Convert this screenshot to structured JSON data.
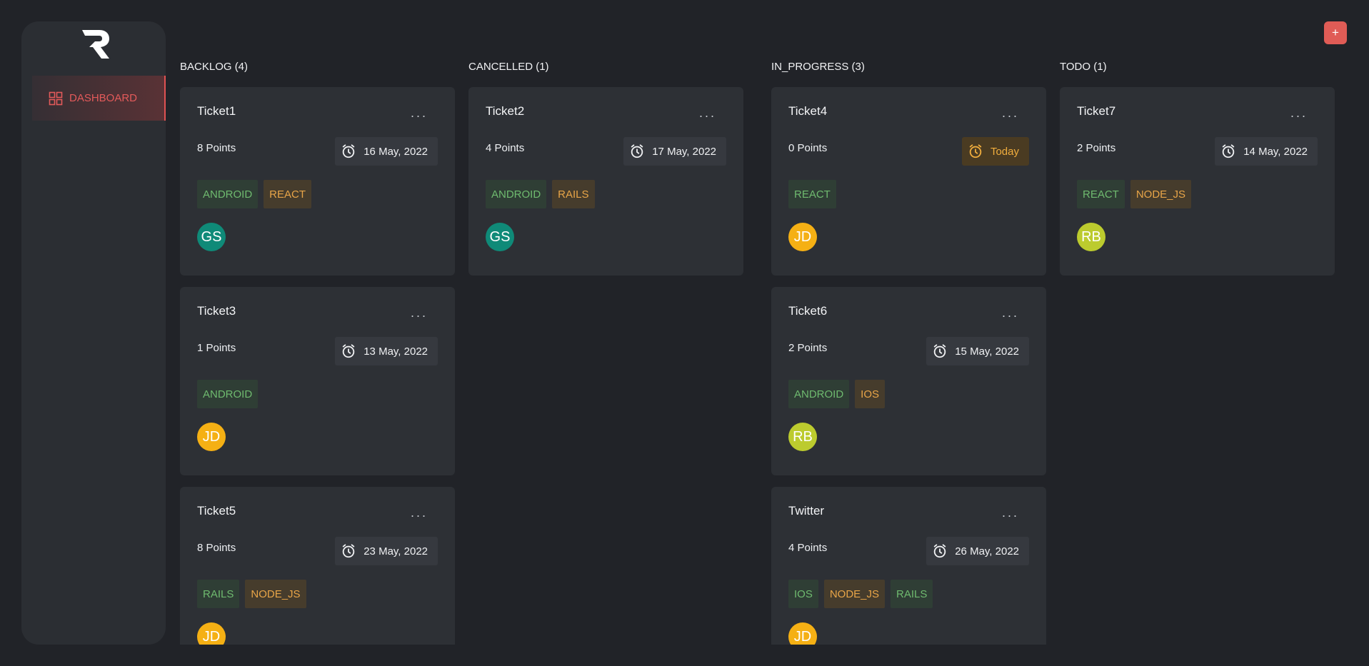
{
  "app": {
    "nav_label": "DASHBOARD",
    "add_button_label": "+"
  },
  "colors": {
    "background": "#212328",
    "card": "#2d3035",
    "accent_red": "#e05c56",
    "tag_green_text": "#6fba6f",
    "tag_orange_text": "#e8a548",
    "avatar_gs": "#0f8a78",
    "avatar_jd": "#f5b014",
    "avatar_rb": "#bccb2e"
  },
  "columns": [
    {
      "header": "BACKLOG (4)",
      "cards": [
        {
          "title": "Ticket1",
          "points": "8 Points",
          "date": "16 May, 2022",
          "today": false,
          "tags": [
            {
              "label": "ANDROID",
              "tone": "green"
            },
            {
              "label": "REACT",
              "tone": "orange"
            }
          ],
          "avatar": {
            "initials": "GS",
            "color": "#0f8a78"
          }
        },
        {
          "title": "Ticket3",
          "points": "1 Points",
          "date": "13 May, 2022",
          "today": false,
          "tags": [
            {
              "label": "ANDROID",
              "tone": "green"
            }
          ],
          "avatar": {
            "initials": "JD",
            "color": "#f5b014"
          }
        },
        {
          "title": "Ticket5",
          "points": "8 Points",
          "date": "23 May, 2022",
          "today": false,
          "tags": [
            {
              "label": "RAILS",
              "tone": "green"
            },
            {
              "label": "NODE_JS",
              "tone": "orange"
            }
          ],
          "avatar": {
            "initials": "JD",
            "color": "#f5b014"
          }
        }
      ]
    },
    {
      "header": "CANCELLED (1)",
      "cards": [
        {
          "title": "Ticket2",
          "points": "4 Points",
          "date": "17 May, 2022",
          "today": false,
          "tags": [
            {
              "label": "ANDROID",
              "tone": "green"
            },
            {
              "label": "RAILS",
              "tone": "orange"
            }
          ],
          "avatar": {
            "initials": "GS",
            "color": "#0f8a78"
          }
        }
      ]
    },
    {
      "header": "IN_PROGRESS (3)",
      "cards": [
        {
          "title": "Ticket4",
          "points": "0 Points",
          "date": "Today",
          "today": true,
          "tags": [
            {
              "label": "REACT",
              "tone": "green"
            }
          ],
          "avatar": {
            "initials": "JD",
            "color": "#f5b014"
          }
        },
        {
          "title": "Ticket6",
          "points": "2 Points",
          "date": "15 May, 2022",
          "today": false,
          "tags": [
            {
              "label": "ANDROID",
              "tone": "green"
            },
            {
              "label": "IOS",
              "tone": "orange"
            }
          ],
          "avatar": {
            "initials": "RB",
            "color": "#bccb2e"
          }
        },
        {
          "title": "Twitter",
          "points": "4 Points",
          "date": "26 May, 2022",
          "today": false,
          "tags": [
            {
              "label": "IOS",
              "tone": "green"
            },
            {
              "label": "NODE_JS",
              "tone": "orange"
            },
            {
              "label": "RAILS",
              "tone": "green"
            }
          ],
          "avatar": {
            "initials": "JD",
            "color": "#f5b014"
          }
        }
      ]
    },
    {
      "header": "TODO (1)",
      "cards": [
        {
          "title": "Ticket7",
          "points": "2 Points",
          "date": "14 May, 2022",
          "today": false,
          "tags": [
            {
              "label": "REACT",
              "tone": "green"
            },
            {
              "label": "NODE_JS",
              "tone": "orange"
            }
          ],
          "avatar": {
            "initials": "RB",
            "color": "#bccb2e"
          }
        }
      ]
    }
  ]
}
